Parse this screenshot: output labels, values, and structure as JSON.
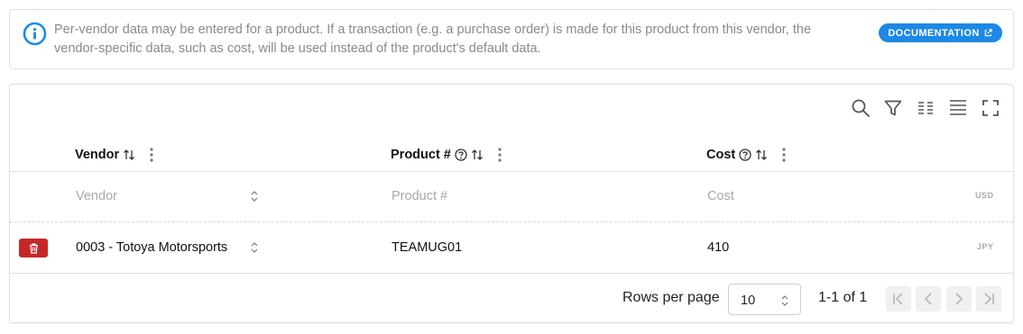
{
  "banner": {
    "message": "Per-vendor data may be entered for a product. If a transaction (e.g. a purchase order) is made for this product from this vendor, the vendor-specific data, such as cost, will be used instead of the product's default data.",
    "documentation_label": "DOCUMENTATION"
  },
  "toolbar": {
    "icons": [
      "search-icon",
      "filter-icon",
      "columns-icon",
      "density-icon",
      "fullscreen-icon"
    ]
  },
  "table": {
    "columns": [
      {
        "label": "Vendor",
        "has_help": false
      },
      {
        "label": "Product #",
        "has_help": true
      },
      {
        "label": "Cost",
        "has_help": true
      }
    ],
    "new_row": {
      "vendor_placeholder": "Vendor",
      "product_placeholder": "Product #",
      "cost_placeholder": "Cost",
      "currency": "USD"
    },
    "rows": [
      {
        "vendor": "0003 - Totoya Motorsports",
        "product": "TEAMUG01",
        "cost": "410",
        "currency": "JPY"
      }
    ]
  },
  "pagination": {
    "rows_per_page_label": "Rows per page",
    "rows_per_page_value": "10",
    "range_text": "1-1 of 1"
  },
  "colors": {
    "accent": "#1e88e5",
    "delete": "#c62828"
  }
}
